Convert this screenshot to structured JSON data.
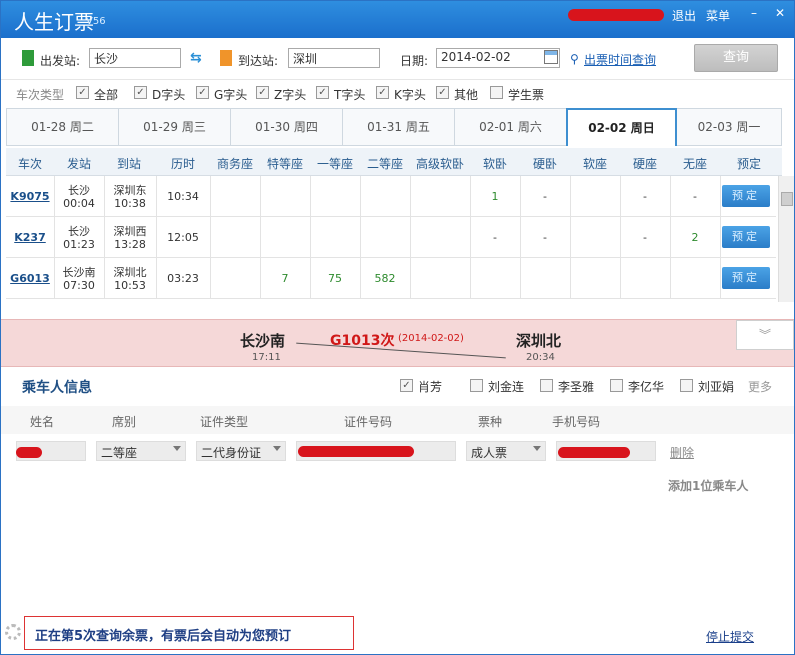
{
  "app": {
    "title": "人生订票",
    "version": "V56",
    "logout": "退出",
    "menu": "菜单",
    "minimize": "–",
    "close": "✕"
  },
  "search": {
    "from_label": "出发站:",
    "from_value": "长沙",
    "to_label": "到达站:",
    "to_value": "深圳",
    "date_label": "日期:",
    "date_value": "2014-02-02",
    "time_query_link": "出票时间查询",
    "query_button": "查询"
  },
  "filters": {
    "label": "车次类型",
    "options": [
      {
        "label": "全部",
        "checked": true
      },
      {
        "label": "D字头",
        "checked": true
      },
      {
        "label": "G字头",
        "checked": true
      },
      {
        "label": "Z字头",
        "checked": true
      },
      {
        "label": "T字头",
        "checked": true
      },
      {
        "label": "K字头",
        "checked": true
      },
      {
        "label": "其他",
        "checked": true
      },
      {
        "label": "学生票",
        "checked": false
      }
    ]
  },
  "date_tabs": [
    {
      "label": "01-28 周二",
      "active": false
    },
    {
      "label": "01-29 周三",
      "active": false
    },
    {
      "label": "01-30 周四",
      "active": false
    },
    {
      "label": "01-31 周五",
      "active": false
    },
    {
      "label": "02-01 周六",
      "active": false
    },
    {
      "label": "02-02 周日",
      "active": true
    },
    {
      "label": "02-03 周一",
      "active": false
    }
  ],
  "table": {
    "headers": [
      "车次",
      "发站",
      "到站",
      "历时",
      "商务座",
      "特等座",
      "一等座",
      "二等座",
      "高级软卧",
      "软卧",
      "硬卧",
      "软座",
      "硬座",
      "无座",
      "预定"
    ],
    "book_label": "预定",
    "rows": [
      {
        "train": "K9075",
        "from": "长沙",
        "dep": "00:04",
        "to": "深圳东",
        "arr": "10:38",
        "duration": "10:34",
        "seats": [
          "",
          "",
          "",
          "",
          "",
          "1",
          "-",
          "",
          "-",
          "-"
        ]
      },
      {
        "train": "K237",
        "from": "长沙",
        "dep": "01:23",
        "to": "深圳西",
        "arr": "13:28",
        "duration": "12:05",
        "seats": [
          "",
          "",
          "",
          "",
          "",
          "-",
          "-",
          "",
          "-",
          "2"
        ]
      },
      {
        "train": "G6013",
        "from": "长沙南",
        "dep": "07:30",
        "to": "深圳北",
        "arr": "10:53",
        "duration": "03:23",
        "seats": [
          "",
          "7",
          "75",
          "582",
          "",
          "",
          "",
          "",
          "",
          ""
        ]
      }
    ]
  },
  "selected": {
    "from_station": "长沙南",
    "dep_time": "17:11",
    "train": "G1013次",
    "date": "(2014-02-02)",
    "to_station": "深圳北",
    "arr_time": "20:34",
    "collapse": "︾"
  },
  "passengers": {
    "title": "乘车人信息",
    "contacts": [
      {
        "name": "肖芳",
        "checked": true
      },
      {
        "name": "刘金连",
        "checked": false
      },
      {
        "name": "李圣雅",
        "checked": false
      },
      {
        "name": "李亿华",
        "checked": false
      },
      {
        "name": "刘亚娟",
        "checked": false
      }
    ],
    "more": "更多",
    "headers": [
      "姓名",
      "席别",
      "证件类型",
      "证件号码",
      "票种",
      "手机号码"
    ],
    "row": {
      "seat": "二等座",
      "id_type": "二代身份证",
      "ticket_type": "成人票"
    },
    "delete": "删除",
    "add": "添加1位乘车人"
  },
  "status": {
    "message": "正在第5次查询余票，有票后会自动为您预订",
    "stop": "停止提交"
  },
  "colors": {
    "accent": "#1b6fcc",
    "redaction": "#d8141c",
    "available": "#2e8b2e",
    "banner": "#f5d8d8"
  }
}
